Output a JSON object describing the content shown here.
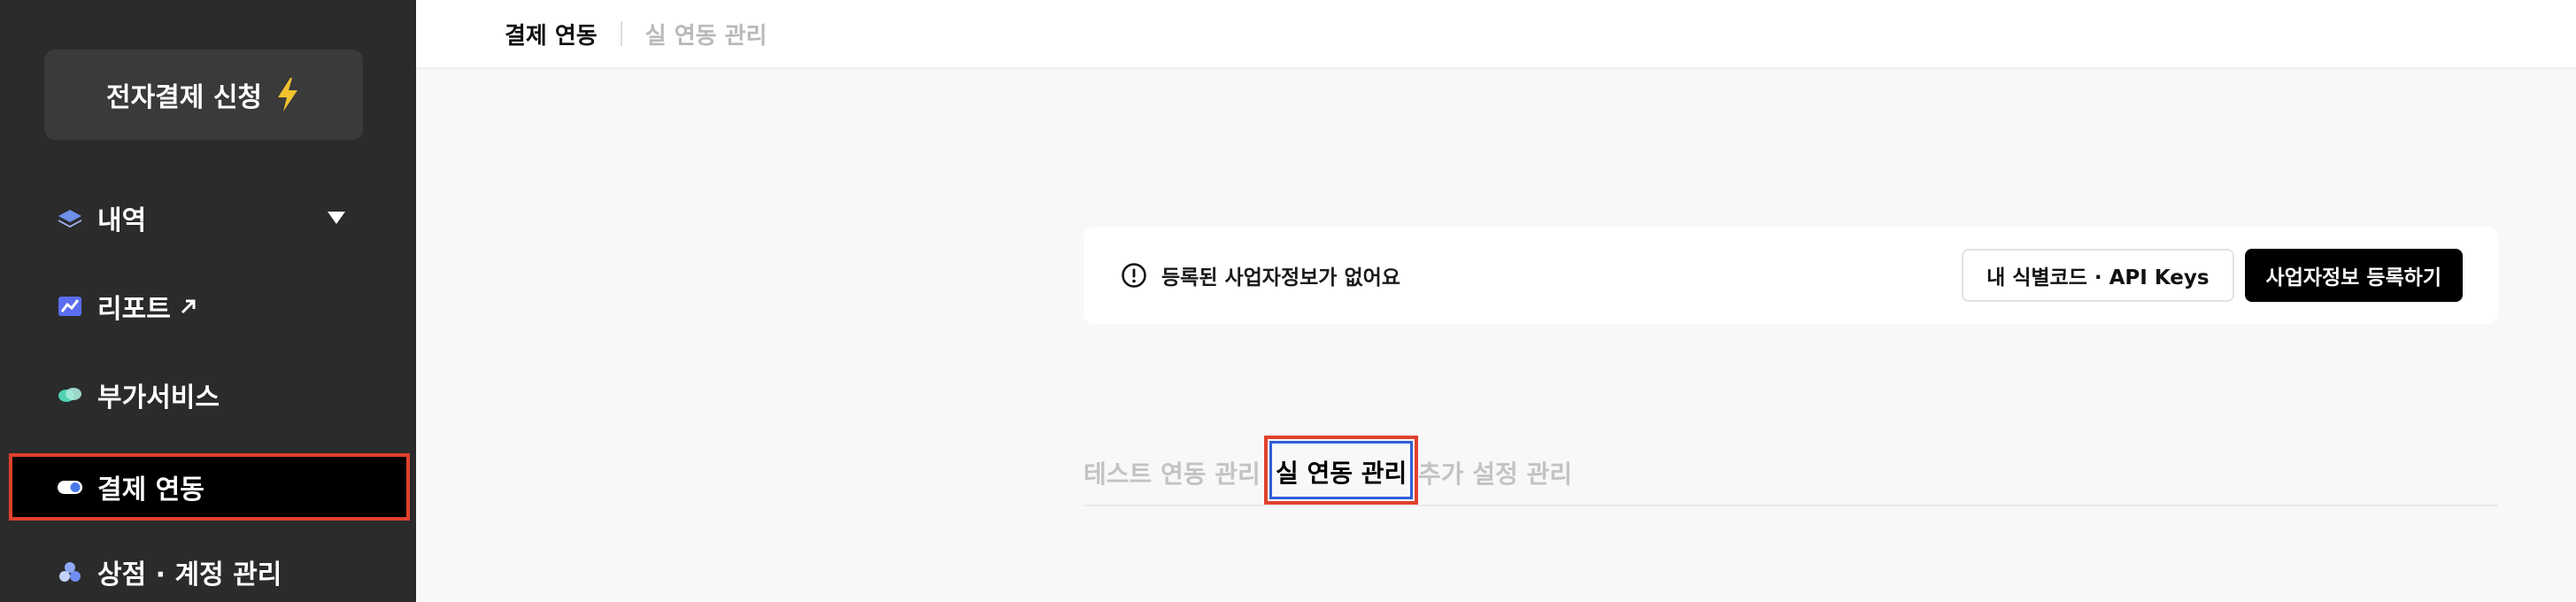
{
  "sidebar": {
    "apply_button": "전자결제 신청",
    "items": [
      {
        "label": "내역",
        "icon": "layers-icon"
      },
      {
        "label": "리포트",
        "icon": "chart-icon"
      },
      {
        "label": "부가서비스",
        "icon": "services-icon"
      },
      {
        "label": "결제 연동",
        "icon": "toggle-icon"
      },
      {
        "label": "상점 · 계정 관리",
        "icon": "store-icon"
      }
    ]
  },
  "breadcrumb": {
    "primary": "결제 연동",
    "secondary": "실 연동 관리"
  },
  "notice": {
    "text": "등록된 사업자정보가 없어요",
    "keys_button": "내 식별코드 · API Keys",
    "register_button": "사업자정보 등록하기"
  },
  "tabs": [
    {
      "label": "테스트 연동 관리"
    },
    {
      "label": "실 연동 관리"
    },
    {
      "label": "추가 설정 관리"
    }
  ],
  "colors": {
    "sidebar_bg": "#2b2b2b",
    "highlight": "#e0412e",
    "focus": "#2f5fd6"
  }
}
